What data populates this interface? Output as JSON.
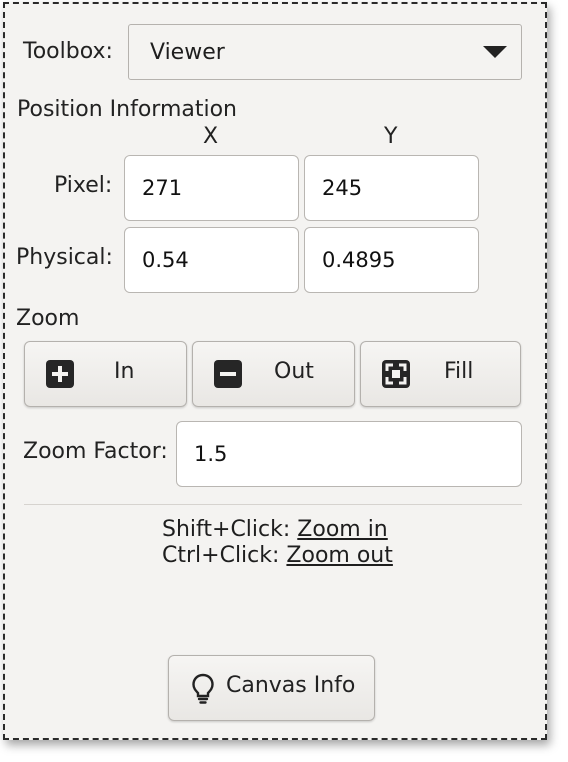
{
  "toolbox": {
    "label": "Toolbox:",
    "selected": "Viewer"
  },
  "position": {
    "heading": "Position Information",
    "col_x": "X",
    "col_y": "Y",
    "pixel_label": "Pixel:",
    "pixel_x": "271",
    "pixel_y": "245",
    "physical_label": "Physical:",
    "physical_x": "0.54",
    "physical_y": "0.4895"
  },
  "zoom": {
    "heading": "Zoom",
    "in_label": "In",
    "out_label": "Out",
    "fill_label": "Fill",
    "factor_label": "Zoom Factor:",
    "factor_value": "1.5"
  },
  "help": {
    "shift_prefix": "Shift+Click:",
    "shift_link": "Zoom in",
    "ctrl_prefix": "Ctrl+Click:",
    "ctrl_link": "Zoom out"
  },
  "canvas_info": {
    "label": "Canvas Info"
  },
  "icons": {
    "zoom_in": "plus-square-icon",
    "zoom_out": "minus-square-icon",
    "fill": "fit-frame-icon",
    "canvas_info": "lightbulb-icon",
    "dropdown": "caret-down-icon"
  }
}
